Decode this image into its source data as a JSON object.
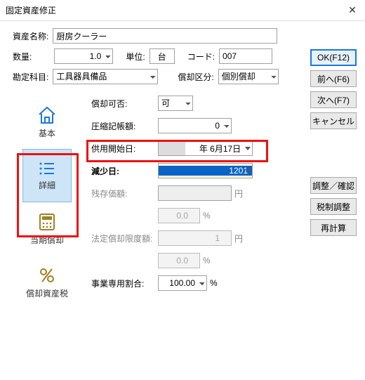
{
  "window": {
    "title": "固定資産修正"
  },
  "buttons": {
    "ok": "OK(F12)",
    "prev": "前へ(F6)",
    "next": "次へ(F7)",
    "cancel": "キャンセル",
    "adjust": "調整／確認",
    "tax": "税制調整",
    "recalc": "再計算"
  },
  "top": {
    "asset_name_label": "資産名称:",
    "asset_name": "厨房クーラー",
    "qty_label": "数量:",
    "qty": "1.0",
    "unit_label": "単位:",
    "unit": "台",
    "code_label": "コード:",
    "code": "007",
    "account_label": "勘定科目:",
    "account": "工具器具備品",
    "div_label": "償却区分:",
    "div": "個別償却"
  },
  "tabs": {
    "basic": "基本",
    "detail": "詳細",
    "periodic": "当期償却",
    "tax": "償却資産税"
  },
  "detail": {
    "dep_allow_label": "償却可否:",
    "dep_allow": "可",
    "compress_label": "圧縮記帳額:",
    "compress": "0",
    "start_label": "供用開始日:",
    "start_date": "年 6月17日",
    "decrease_label": "減少日:",
    "decrease": "1201",
    "residual_label": "残存価額:",
    "residual": "",
    "residual_pct": "0.0",
    "limit_label": "法定償却限度額:",
    "limit": "1",
    "limit_pct": "0.0",
    "bizratio_label": "事業専用割合:",
    "bizratio": "100.00",
    "yen": "円",
    "pct": "%"
  }
}
